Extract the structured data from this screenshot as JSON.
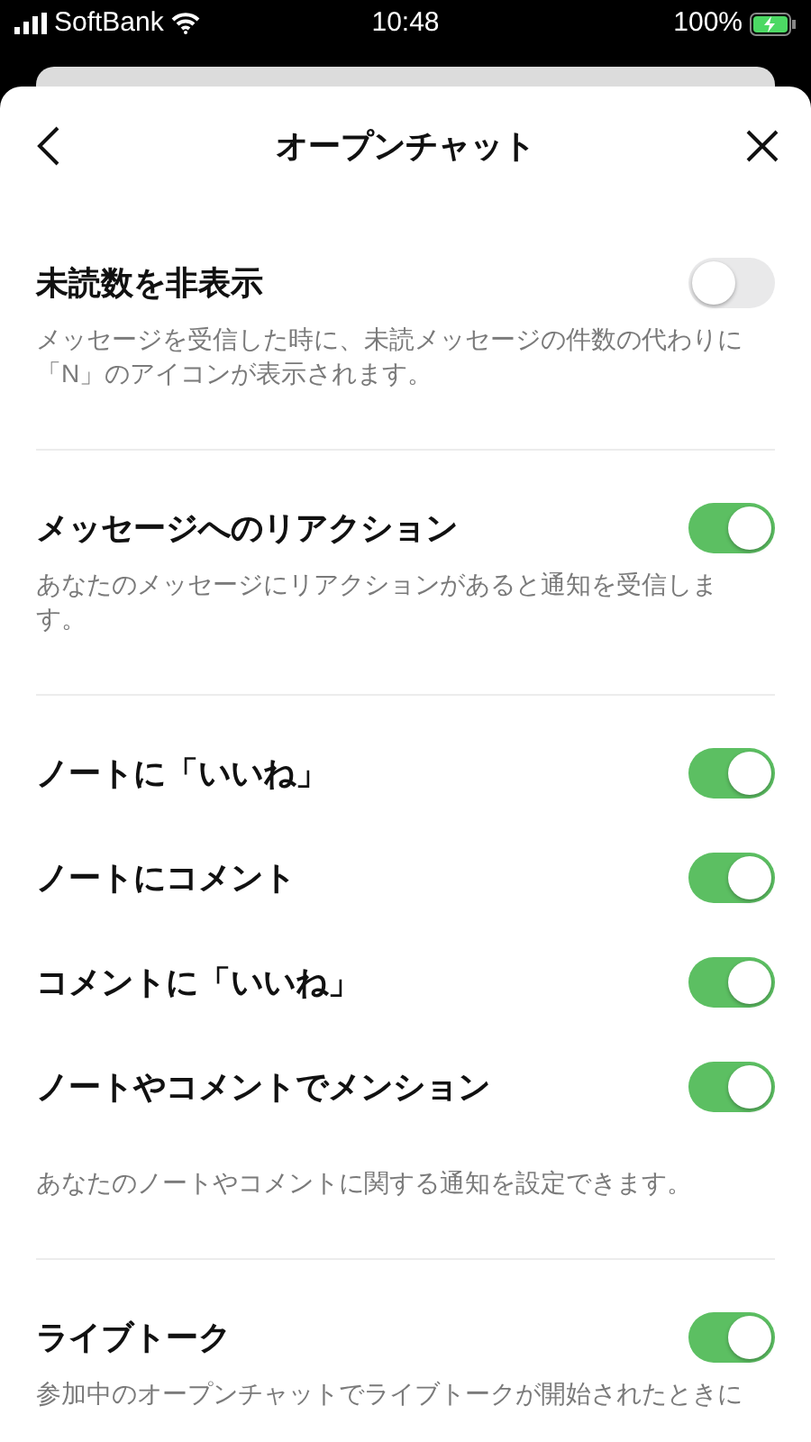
{
  "status_bar": {
    "carrier": "SoftBank",
    "time": "10:48",
    "battery": "100%"
  },
  "header": {
    "title": "オープンチャット"
  },
  "sections": [
    {
      "items": [
        {
          "label": "未読数を非表示",
          "on": false
        }
      ],
      "description": "メッセージを受信した時に、未読メッセージの件数の代わりに「N」のアイコンが表示されます。"
    },
    {
      "items": [
        {
          "label": "メッセージへのリアクション",
          "on": true
        }
      ],
      "description": "あなたのメッセージにリアクションがあると通知を受信します。"
    },
    {
      "items": [
        {
          "label": "ノートに「いいね」",
          "on": true
        },
        {
          "label": "ノートにコメント",
          "on": true
        },
        {
          "label": "コメントに「いいね」",
          "on": true
        },
        {
          "label": "ノートやコメントでメンション",
          "on": true
        }
      ],
      "description": "あなたのノートやコメントに関する通知を設定できます。"
    },
    {
      "items": [
        {
          "label": "ライブトーク",
          "on": true
        }
      ],
      "description": "参加中のオープンチャットでライブトークが開始されたときに"
    }
  ]
}
